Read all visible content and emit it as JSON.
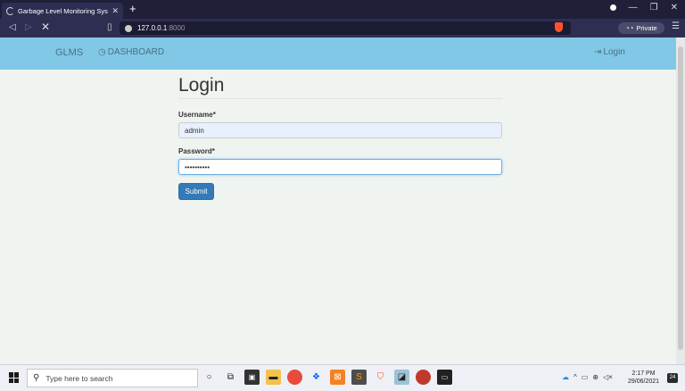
{
  "browser": {
    "tab_title": "Garbage Level Monitoring System",
    "new_tab": "+",
    "url_host": "127.0.0.1",
    "url_port": ":8000",
    "private_label": "Private"
  },
  "site_nav": {
    "brand": "GLMS",
    "dashboard": "DASHBOARD",
    "login": "Login"
  },
  "form": {
    "title": "Login",
    "username_label": "Username*",
    "username_value": "admin",
    "password_label": "Password*",
    "password_value": "••••••••••",
    "submit_label": "Submit"
  },
  "taskbar": {
    "search_placeholder": "Type here to search",
    "time": "2:17 PM",
    "date": "29/06/2021",
    "notifications": "24"
  },
  "icons": {
    "accent": "#80c8e6",
    "button": "#337ab7"
  }
}
